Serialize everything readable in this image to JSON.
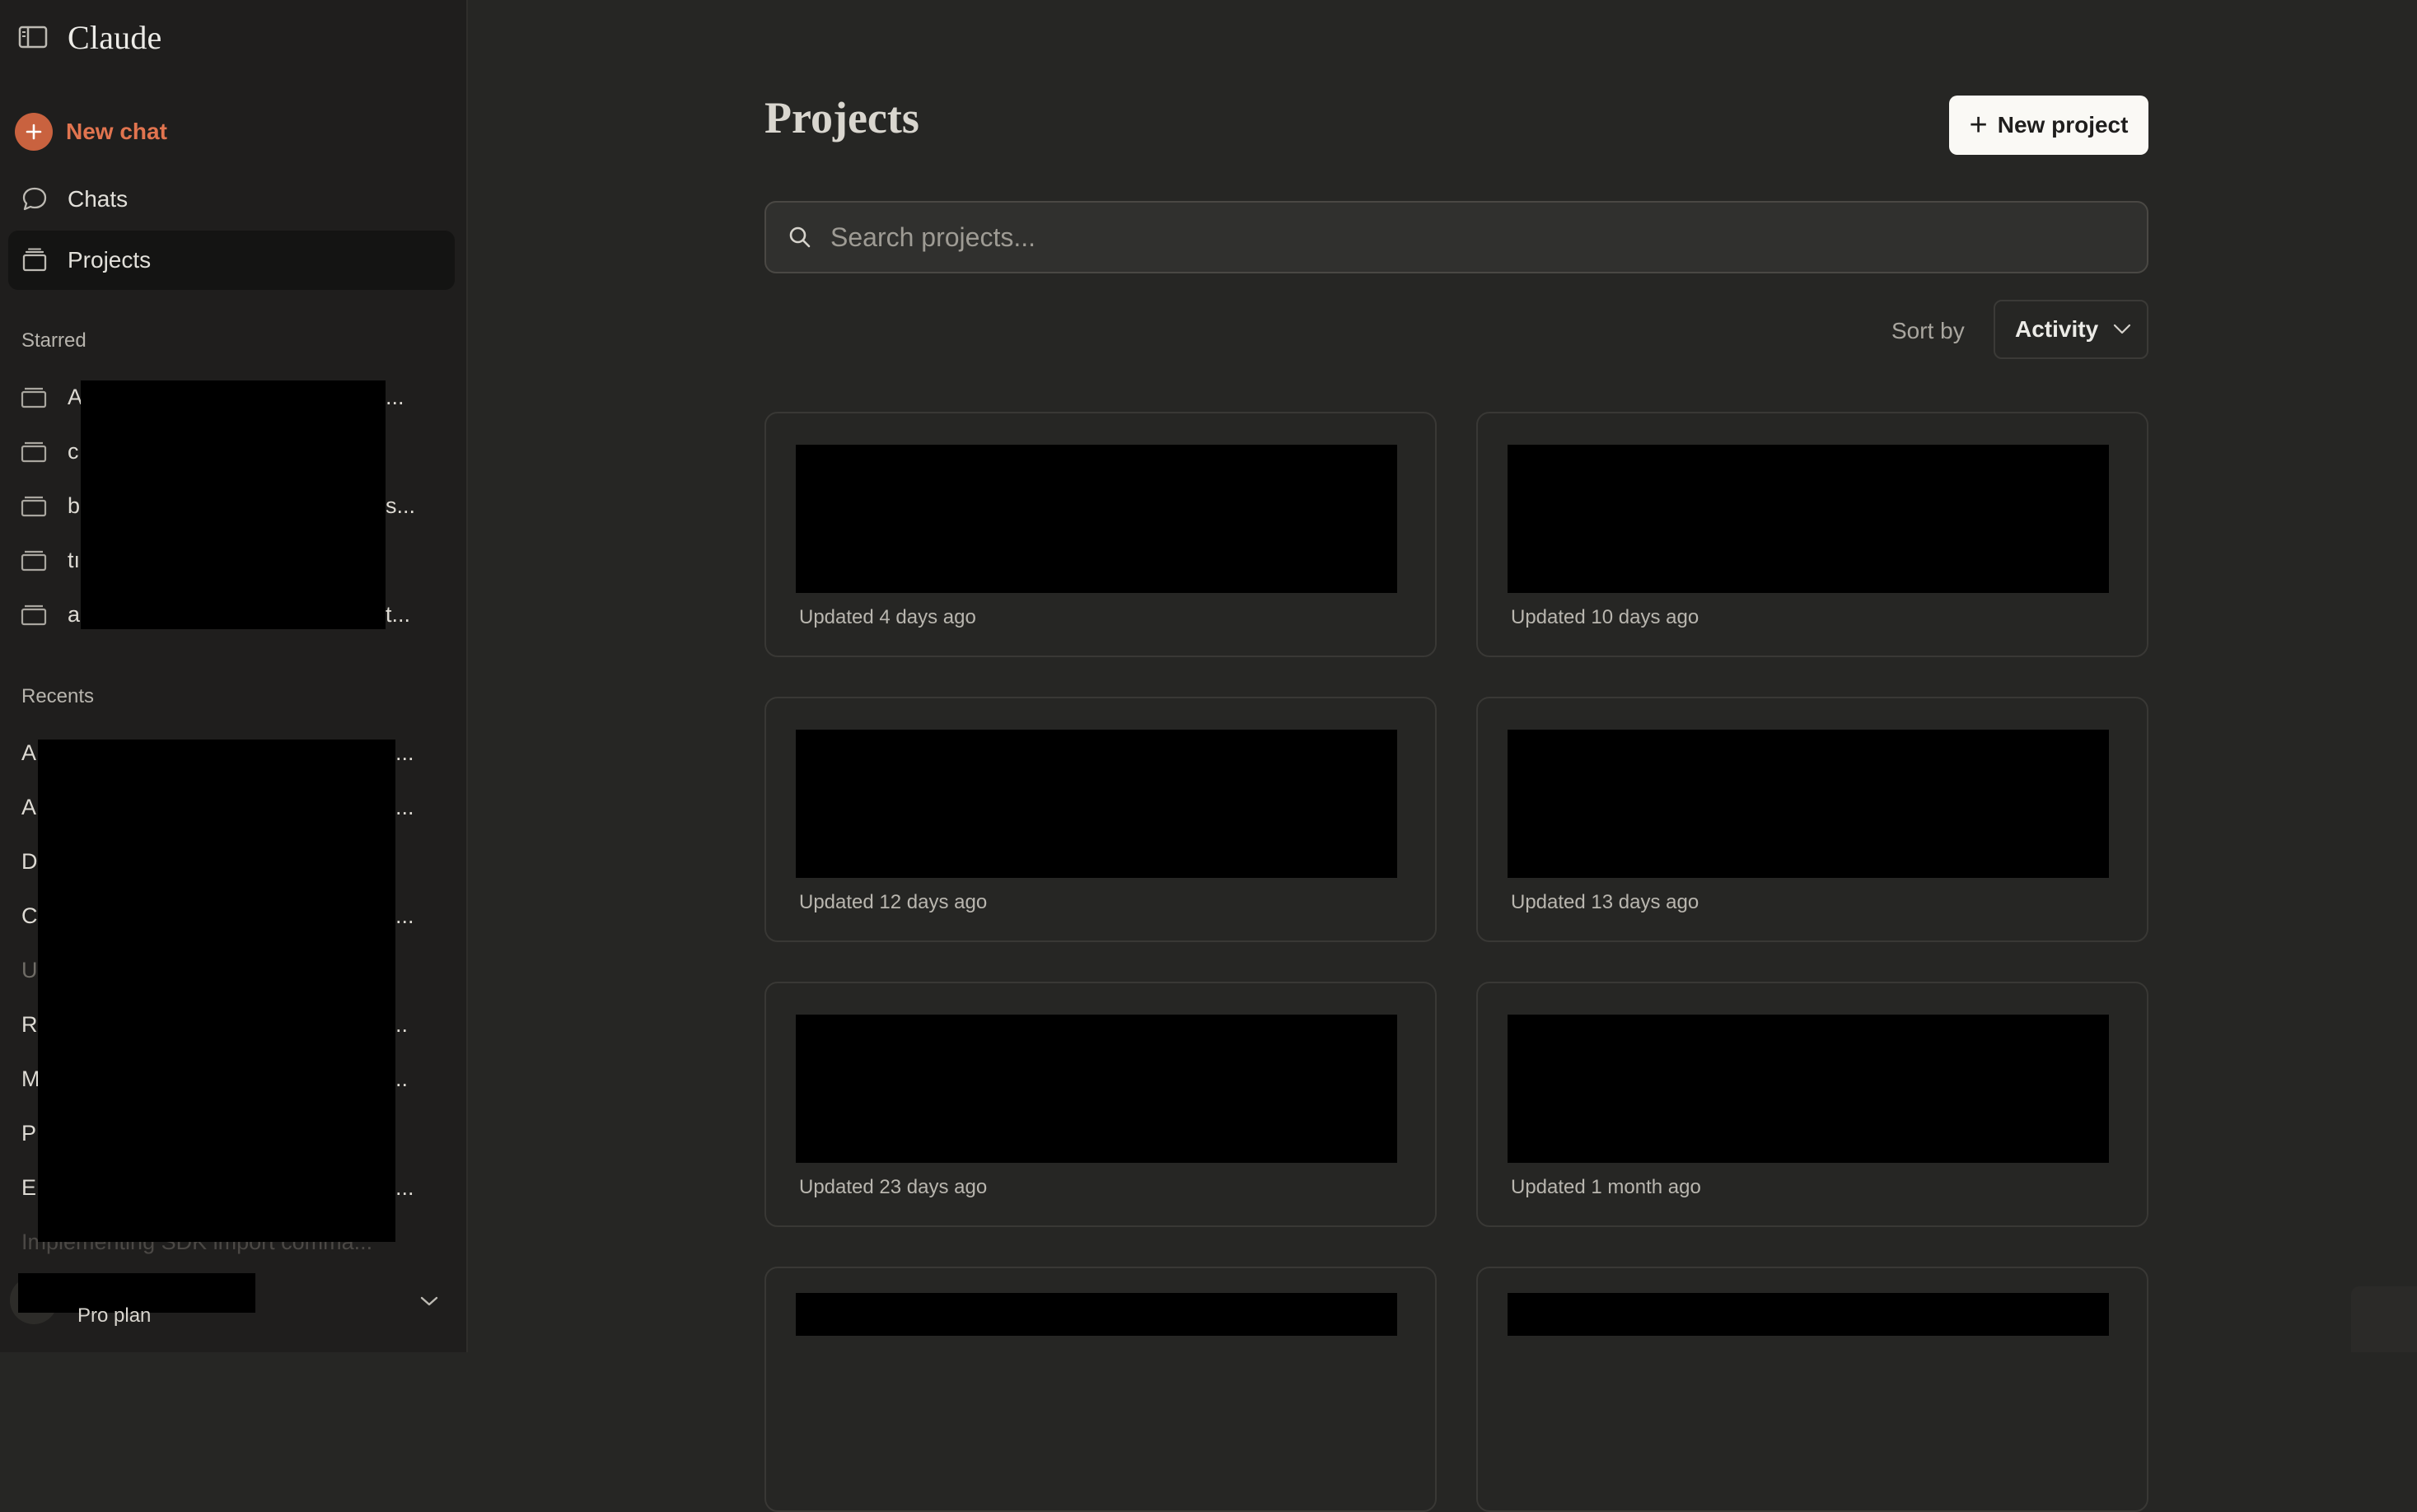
{
  "app": {
    "brand": "Claude"
  },
  "sidebar": {
    "new_chat_label": "New chat",
    "chats_label": "Chats",
    "projects_label": "Projects",
    "starred_label": "Starred",
    "starred_items": [
      {
        "first": "A",
        "tail": "..."
      },
      {
        "first": "c",
        "tail": ""
      },
      {
        "first": "b",
        "tail": "s..."
      },
      {
        "first": "tı",
        "tail": ""
      },
      {
        "first": "a",
        "tail": "t..."
      }
    ],
    "recents_label": "Recents",
    "recent_items": [
      {
        "first": "A",
        "tail": "..."
      },
      {
        "first": "A",
        "tail": "..."
      },
      {
        "first": "D",
        "tail": ""
      },
      {
        "first": "C",
        "tail": "..."
      },
      {
        "first": "U",
        "tail": ""
      },
      {
        "first": "R",
        "tail": ".."
      },
      {
        "first": "M",
        "tail": ".."
      },
      {
        "first": "P",
        "tail": ""
      },
      {
        "first": "E",
        "tail": "..."
      },
      {
        "first": "Implementing SDK import comma...",
        "tail": ""
      }
    ],
    "footer": {
      "plan_label": "Pro plan"
    }
  },
  "main": {
    "title": "Projects",
    "new_project_label": "New project",
    "search_placeholder": "Search projects...",
    "sort_label": "Sort by",
    "sort_value": "Activity",
    "projects": [
      {
        "updated": "Updated 4 days ago"
      },
      {
        "updated": "Updated 10 days ago"
      },
      {
        "updated": "Updated 12 days ago"
      },
      {
        "updated": "Updated 13 days ago"
      },
      {
        "updated": "Updated 23 days ago"
      },
      {
        "updated": "Updated 1 month ago"
      },
      {
        "updated": ""
      },
      {
        "updated": ""
      }
    ]
  },
  "colors": {
    "sidebar_bg": "#1f1e1d",
    "main_bg": "#262624",
    "accent": "#c9623f",
    "button_bg": "#faf9f5"
  },
  "icons": {
    "sidebar_toggle": "panel-left-icon",
    "new_chat": "plus-circle-icon",
    "chats": "chat-bubble-icon",
    "projects": "folder-stack-icon",
    "search": "search-icon",
    "sort": "chevron-down-icon"
  }
}
